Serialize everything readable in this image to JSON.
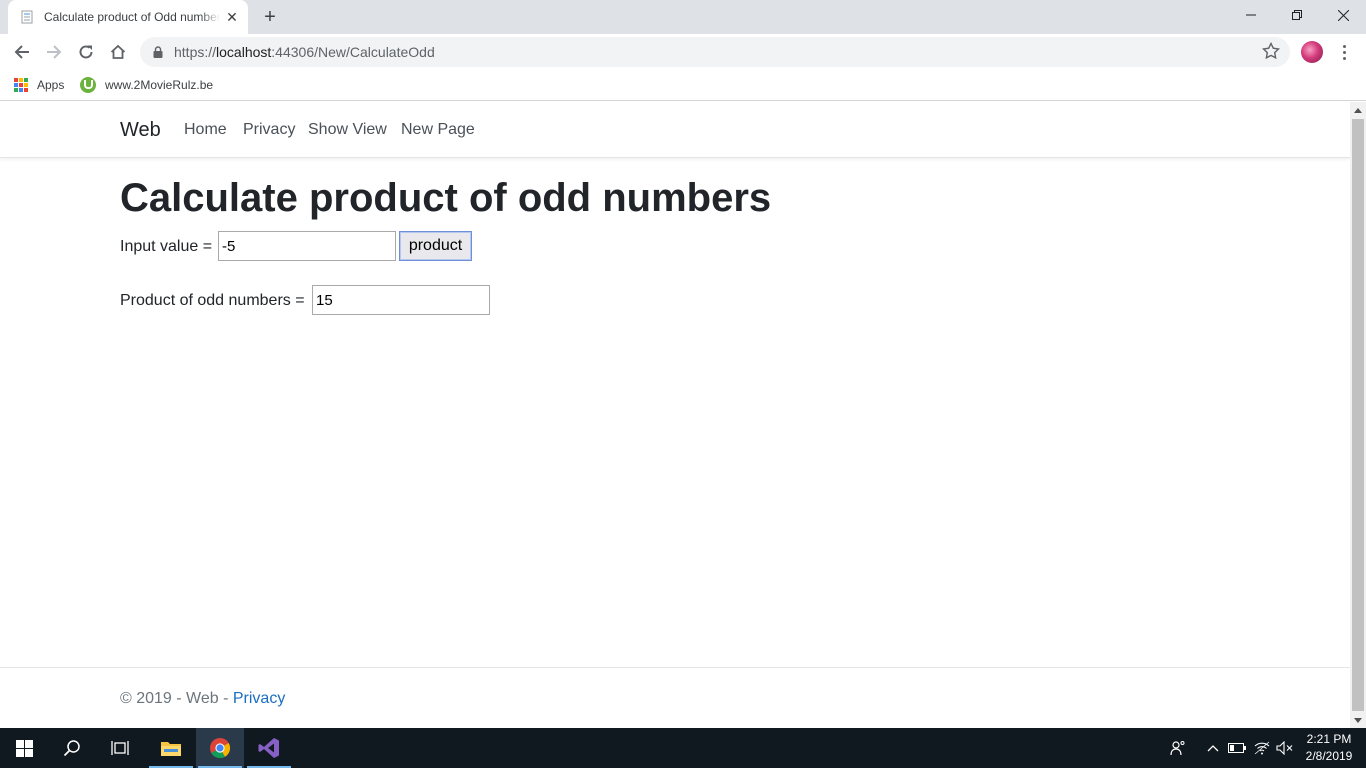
{
  "browser": {
    "tab_title": "Calculate product of Odd numbers",
    "tab_close": "✕",
    "new_tab": "+",
    "url_scheme": "https://",
    "url_host": "localhost",
    "url_path": ":44306/New/CalculateOdd",
    "bookmarks": [
      {
        "label": "Apps",
        "icon": "apps-grid-icon"
      },
      {
        "label": "www.2MovieRulz.be",
        "icon": "utorrent-icon"
      }
    ]
  },
  "site": {
    "brand": "Web",
    "nav": [
      "Home",
      "Privacy",
      "Show View",
      "New Page"
    ],
    "heading": "Calculate product of odd numbers",
    "input_label": "Input value =",
    "input_value": "-5",
    "button_label": "product",
    "result_label": "Product of odd numbers =",
    "result_value": "15",
    "footer_text": "© 2019 - Web - ",
    "footer_link": "Privacy"
  },
  "taskbar": {
    "time": "2:21 PM",
    "date": "2/8/2019"
  },
  "colors": {
    "link": "#1b6ec2",
    "taskbar": "#101820",
    "tab_strip": "#dee1e6"
  }
}
